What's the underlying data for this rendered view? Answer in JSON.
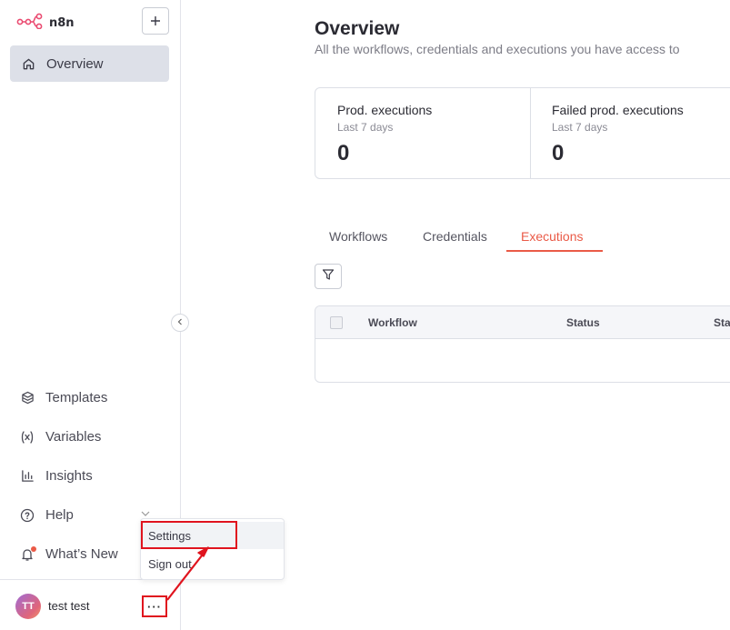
{
  "app": {
    "name": "n8n",
    "accent_color": "#ea5a47",
    "annotation_color": "#e0141e"
  },
  "sidebar": {
    "add_button_icon": "plus-icon",
    "overview": {
      "label": "Overview",
      "icon": "home-icon"
    },
    "items": [
      {
        "label": "Templates",
        "icon": "box-icon"
      },
      {
        "label": "Variables",
        "icon": "variable-icon"
      },
      {
        "label": "Insights",
        "icon": "bar-chart-icon"
      },
      {
        "label": "Help",
        "icon": "question-circle-icon"
      },
      {
        "label": "What’s New",
        "icon": "bell-icon"
      }
    ],
    "user": {
      "initials": "TT",
      "name": "test test",
      "more_label": "···"
    }
  },
  "user_menu": {
    "items": [
      {
        "label": "Settings"
      },
      {
        "label": "Sign out"
      }
    ]
  },
  "main": {
    "title": "Overview",
    "subtitle": "All the workflows, credentials and executions you have access to",
    "stats": [
      {
        "label": "Prod. executions",
        "sub": "Last 7 days",
        "value": "0"
      },
      {
        "label": "Failed prod. executions",
        "sub": "Last 7 days",
        "value": "0"
      }
    ],
    "tabs": [
      {
        "label": "Workflows"
      },
      {
        "label": "Credentials"
      },
      {
        "label": "Executions",
        "active": true
      }
    ],
    "table": {
      "columns": [
        "Workflow",
        "Status",
        "Sta"
      ]
    }
  }
}
